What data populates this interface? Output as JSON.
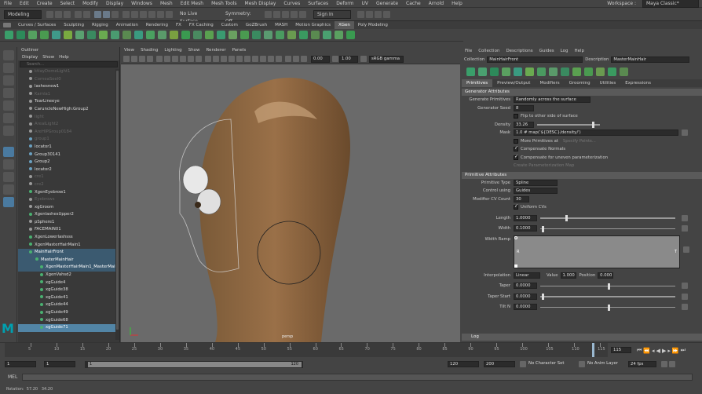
{
  "menubar": {
    "items": [
      "File",
      "Edit",
      "Create",
      "Select",
      "Modify",
      "Display",
      "Windows",
      "Mesh",
      "Edit Mesh",
      "Mesh Tools",
      "Mesh Display",
      "Curves",
      "Surfaces",
      "Deform",
      "UV",
      "Generate",
      "Cache",
      "Arnold",
      "Help"
    ],
    "workspace_label": "Workspace :",
    "workspace_value": "Maya Classic*"
  },
  "status": {
    "mode": "Modeling",
    "live": "No Live Surface",
    "symmetry": "Symmetry: Off",
    "signin": "Sign In"
  },
  "shelf_tabs": [
    "Curves / Surfaces",
    "Sculpting",
    "Rigging",
    "Animation",
    "Rendering",
    "FX",
    "FX Caching",
    "Custom",
    "GoZBrush",
    "MASH",
    "Motion Graphics",
    "XGen",
    "Poly Modeling"
  ],
  "active_shelf": "XGen",
  "outliner": {
    "title": "Outliner",
    "menu": [
      "Display",
      "Show",
      "Help"
    ],
    "search_placeholder": "Search...",
    "items": [
      {
        "label": "ktiayDomeLight1",
        "dim": true
      },
      {
        "label": "CorneaSeel0",
        "dim": true
      },
      {
        "label": "lashesnew1",
        "dim": false
      },
      {
        "label": "Karnla1",
        "dim": true
      },
      {
        "label": "TearLineeye",
        "dim": false
      },
      {
        "label": "CaruncleNewHigh:Group2",
        "dim": false
      },
      {
        "label": "Iight",
        "dim": true
      },
      {
        "label": "ArealLight2",
        "dim": true
      },
      {
        "label": "AreHIPGroup0184",
        "dim": true
      },
      {
        "label": "group1",
        "dim": true
      },
      {
        "label": "locator1",
        "dim": false
      },
      {
        "label": "Group30141",
        "dim": false
      },
      {
        "label": "Group2",
        "dim": false
      },
      {
        "label": "locator2",
        "dim": false
      },
      {
        "label": "cre1",
        "dim": true
      },
      {
        "label": "cre2",
        "dim": true
      },
      {
        "label": "XgenEyebrow1",
        "dim": false
      },
      {
        "label": "Eyebrows",
        "dim": true
      },
      {
        "label": "xgGroom",
        "dim": false
      },
      {
        "label": "XgenlashesUpper2",
        "dim": false
      },
      {
        "label": "pSphere1",
        "dim": false
      },
      {
        "label": "FACEMAIN01",
        "dim": false
      },
      {
        "label": "XgenLowerlashsss",
        "dim": false
      },
      {
        "label": "XgenMasterHairMain1",
        "dim": false
      },
      {
        "label": "MainHairFront",
        "dim": false,
        "sel": "sel2"
      },
      {
        "label": "MasterMainHair",
        "dim": false,
        "sel": "sel2"
      },
      {
        "label": "XgenMasterHairMain1_MasterMainHair",
        "dim": false,
        "sel": "sel2"
      },
      {
        "label": "XgenVahsd2",
        "dim": false
      },
      {
        "label": "xgGuide4",
        "dim": false
      },
      {
        "label": "xgGuide38",
        "dim": false
      },
      {
        "label": "xgGuide41",
        "dim": false
      },
      {
        "label": "xgGuide44",
        "dim": false
      },
      {
        "label": "xgGuide49",
        "dim": false
      },
      {
        "label": "xgGuide68",
        "dim": false
      },
      {
        "label": "xgGuide71",
        "dim": false,
        "sel": "sel"
      }
    ]
  },
  "viewport": {
    "menu": [
      "View",
      "Shading",
      "Lighting",
      "Show",
      "Renderer",
      "Panels"
    ],
    "field1": "0.00",
    "field2": "1.00",
    "colorspace": "sRGB gamma",
    "camera": "persp"
  },
  "xgen": {
    "menu": [
      "File",
      "Collection",
      "Descriptions",
      "Guides",
      "Log",
      "Help"
    ],
    "collection_label": "Collection",
    "collection_value": "MainHairFront",
    "description_label": "Description",
    "description_value": "MasterMainHair",
    "tabs": [
      "Primitives",
      "Preview/Output",
      "Modifiers",
      "Grooming",
      "Utilities",
      "Expressions"
    ],
    "gen_header": "Generator Attributes",
    "gen_prims_label": "Generate Primitives",
    "gen_prims_value": "Randomly across the surface",
    "seed_label": "Generator Seed",
    "seed_value": "8",
    "flip_label": "Flip to other side of surface",
    "density_label": "Density",
    "density_value": "33.26",
    "mask_label": "Mask",
    "mask_value": "1.0 # map('${DESC}/density/')",
    "more_label": "More Primitives at",
    "specify_label": "Specify Points...",
    "comp_normals": "Compensate Normals",
    "comp_uneven": "Compensate for uneven parameterization",
    "create_map": "Create Parameterization Map",
    "prim_header": "Primitive Attributes",
    "prim_type_label": "Primitive Type",
    "prim_type_value": "Spline",
    "control_label": "Control using",
    "control_value": "Guides",
    "modcv_label": "Modifier CV Count",
    "modcv_value": "30",
    "uniform_label": "Uniform CVs",
    "length_label": "Length",
    "length_value": "1.0000",
    "width_label": "Width",
    "width_value": "0.1000",
    "ramp_label": "Width Ramp",
    "ramp_r": "R",
    "ramp_t": "T",
    "interp_label": "Interpolation",
    "interp_value": "Linear",
    "value_label": "Value",
    "value_value": "1.000",
    "position_label": "Position",
    "position_value": "0.000",
    "taper_label": "Taper",
    "taper_value": "0.0000",
    "taperstart_label": "Taper Start",
    "taperstart_value": "0.0000",
    "tiltn_label": "Tilt N",
    "tiltn_value": "0.0000",
    "log_label": "Log"
  },
  "timeline": {
    "ticks": [
      "5",
      "10",
      "15",
      "20",
      "25",
      "30",
      "35",
      "40",
      "45",
      "50",
      "55",
      "60",
      "65",
      "70",
      "75",
      "80",
      "85",
      "90",
      "95",
      "100",
      "105",
      "110",
      "115"
    ],
    "current": "115"
  },
  "range": {
    "start": "1",
    "inner_start": "1",
    "slider_start": "1",
    "slider_end": "120",
    "end": "120",
    "outer_end": "200",
    "char_set": "No Character Set",
    "anim_layer": "No Anim Layer",
    "fps": "24 fps"
  },
  "mel": {
    "label": "MEL"
  },
  "help": {
    "text": "Rotation:  57.20   34.20"
  },
  "colors": {
    "accent": "#5285a6",
    "bg": "#444444",
    "viewport": "#6a6a6a",
    "maya_logo": "#00a0b0"
  }
}
